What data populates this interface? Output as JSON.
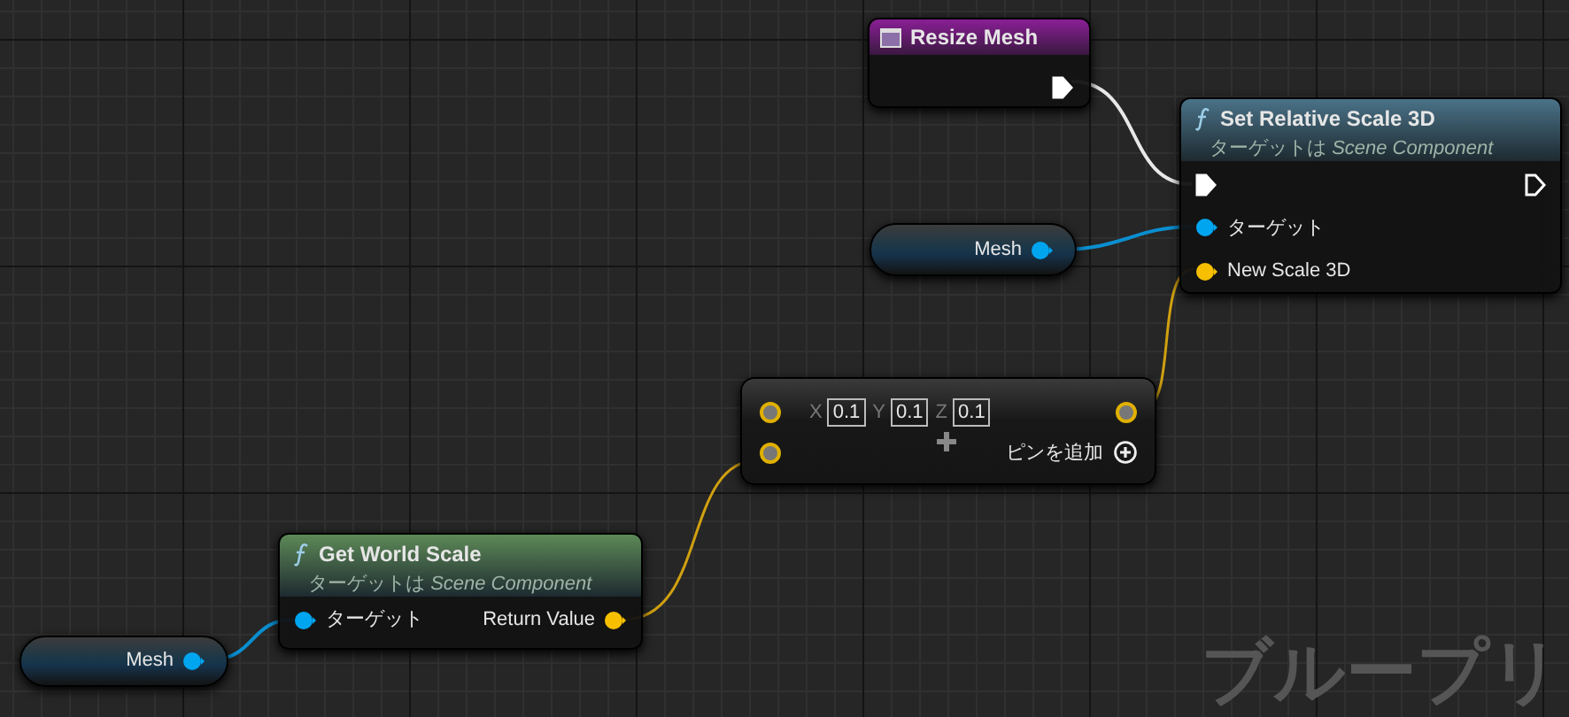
{
  "nodes": [
    {
      "kind": "event",
      "title": "Resize Mesh",
      "exec_out": {
        "connected": true
      }
    },
    {
      "kind": "function",
      "title": "Set Relative Scale 3D",
      "subtitle": "ターゲットは *Scene Component*",
      "color": "#4a7288",
      "exec_in": {
        "connected": true
      },
      "exec_out": {
        "connected": false
      },
      "inputs": [
        {
          "kind": "object",
          "label": "ターゲット"
        },
        {
          "kind": "vector",
          "label": "New Scale 3D"
        }
      ]
    },
    {
      "kind": "variable",
      "label": "Mesh"
    },
    {
      "kind": "make",
      "fields": [
        {
          "axis": "X",
          "value": "0.1"
        },
        {
          "axis": "Y",
          "value": "0.1"
        },
        {
          "axis": "Z",
          "value": "0.1"
        }
      ],
      "add_pin": "ピンを追加"
    },
    {
      "kind": "function",
      "title": "Get World Scale",
      "subtitle": "ターゲットは *Scene Component*",
      "color": "#5d8957",
      "inputs": [
        {
          "kind": "object",
          "label": "ターゲット"
        }
      ],
      "outputs": [
        {
          "kind": "vector",
          "label": "Return Value"
        }
      ]
    },
    {
      "kind": "variable",
      "label": "Mesh"
    }
  ],
  "watermark_text": "ブループリ"
}
